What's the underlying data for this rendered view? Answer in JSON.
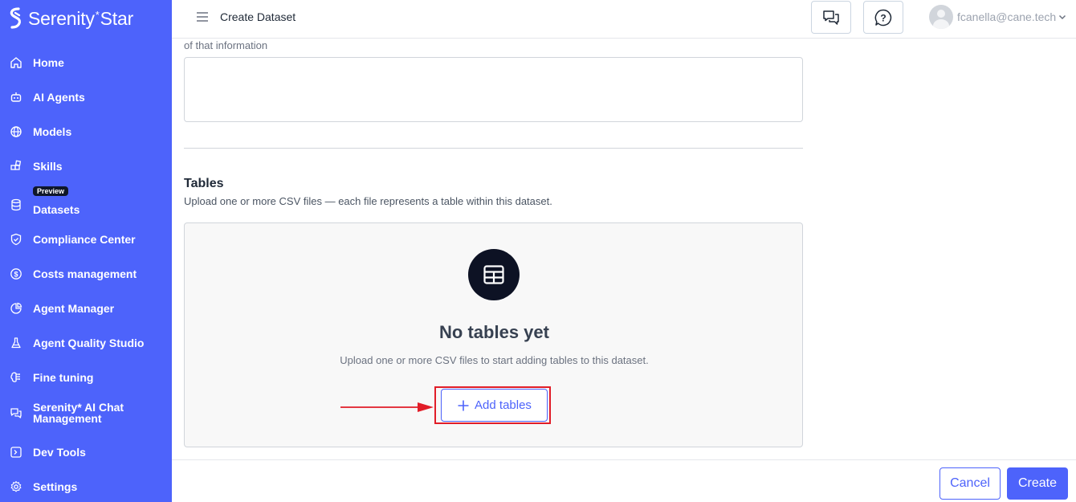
{
  "app": {
    "logo_text": "Serenity",
    "logo_sup": "*",
    "logo_text2": "Star"
  },
  "header": {
    "title": "Create Dataset",
    "chat_icon": "chat-bubbles-icon",
    "help_icon": "help-question-icon",
    "user_email": "fcanella@cane.tech"
  },
  "sidebar": {
    "items": [
      {
        "label": "Home",
        "icon": "home-icon"
      },
      {
        "label": "AI Agents",
        "icon": "robot-icon"
      },
      {
        "label": "Models",
        "icon": "globe-icon"
      },
      {
        "label": "Skills",
        "icon": "blocks-icon"
      },
      {
        "label": "Datasets",
        "icon": "database-icon",
        "badge": "Preview"
      },
      {
        "label": "Compliance Center",
        "icon": "shield-check-icon"
      },
      {
        "label": "Costs management",
        "icon": "dollar-circle-icon"
      },
      {
        "label": "Agent Manager",
        "icon": "pie-chart-icon"
      },
      {
        "label": "Agent Quality Studio",
        "icon": "flask-icon"
      },
      {
        "label": "Fine tuning",
        "icon": "brain-icon"
      },
      {
        "label": "Serenity* AI Chat Management",
        "icon": "chat-icon"
      },
      {
        "label": "Dev Tools",
        "icon": "terminal-icon"
      },
      {
        "label": "Settings",
        "icon": "gear-icon"
      }
    ]
  },
  "form": {
    "description_tail": "of that information",
    "description_value": "",
    "tables_title": "Tables",
    "tables_subtitle": "Upload one or more CSV files — each file represents a table within this dataset.",
    "empty_title": "No tables yet",
    "empty_subtitle": "Upload one or more CSV files to start adding tables to this dataset.",
    "add_button": "Add tables"
  },
  "footer": {
    "cancel": "Cancel",
    "create": "Create"
  },
  "colors": {
    "primary": "#4d63fb",
    "highlight": "#e11d28",
    "icon_bg": "#0d1224"
  }
}
